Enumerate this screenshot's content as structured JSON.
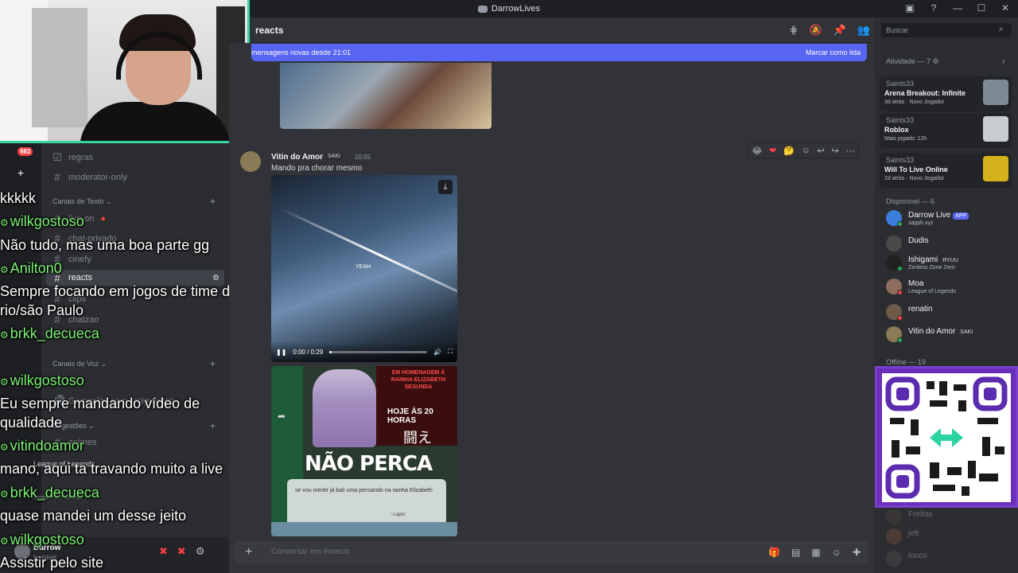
{
  "window": {
    "title": "DarrowLives",
    "controls": [
      "—",
      "☐",
      "✕"
    ]
  },
  "servers": {
    "badge": "983",
    "add_label": "+"
  },
  "channels": {
    "items": [
      {
        "label": "regras",
        "type": "rules"
      },
      {
        "label": "moderator-only",
        "type": "text"
      },
      {
        "label": "live-on",
        "type": "text"
      },
      {
        "label": "chat-privado",
        "type": "text"
      },
      {
        "label": "cinefy",
        "type": "text"
      },
      {
        "label": "reacts",
        "type": "text",
        "active": true
      },
      {
        "label": "clips",
        "type": "text"
      },
      {
        "label": "chatzao",
        "type": "text"
      },
      {
        "label": "Gameplay com amiguinhos",
        "type": "voice"
      },
      {
        "label": "animes",
        "type": "voice"
      }
    ],
    "categories": [
      {
        "label": "Canais de Texto ⌄"
      },
      {
        "label": "Canais de Voz ⌄"
      },
      {
        "label": "Sugestões ⌄"
      }
    ],
    "voice": {
      "game": "League of Legends",
      "sub": "Jogos Priv / valoras"
    }
  },
  "user": {
    "name": "Darrow",
    "status": "Invisível"
  },
  "overlay_chat": [
    {
      "kind": "msg",
      "text": "kkkkk"
    },
    {
      "kind": "user",
      "text": "wilkgostoso"
    },
    {
      "kind": "msg",
      "text": "Não tudo, mas uma boa parte gg"
    },
    {
      "kind": "user",
      "text": "Anilton0"
    },
    {
      "kind": "msg",
      "text": "Sempre focando em jogos de time do"
    },
    {
      "kind": "msg",
      "text": "rio/são Paulo"
    },
    {
      "kind": "user",
      "text": "brkk_decueca"
    },
    {
      "kind": "user",
      "text": "wilkgostoso"
    },
    {
      "kind": "msg",
      "text": "Eu sempre mandando vídeo de"
    },
    {
      "kind": "msg",
      "text": "qualidade"
    },
    {
      "kind": "user",
      "text": "vitindoamor"
    },
    {
      "kind": "msg",
      "text": "mano, aqui ta travando muito a live"
    },
    {
      "kind": "user",
      "text": "brkk_decueca"
    },
    {
      "kind": "msg",
      "text": "quase mandei um desse jeito"
    },
    {
      "kind": "user",
      "text": "wilkgostoso"
    },
    {
      "kind": "msg",
      "text": "Assistir pelo site"
    }
  ],
  "channel_header": {
    "name": "reacts"
  },
  "new_messages": {
    "text": "mensagens novas desde 21:01",
    "action": "Marcar como lida"
  },
  "message": {
    "author": "Vitin do Amor",
    "tag": "SAKI",
    "time": "20:55",
    "text": "Mando pra chorar mesmo",
    "video": {
      "caption": "YEAH",
      "time": "0:00 / 0:29",
      "progress": 0.0
    },
    "image": {
      "banner": "EM HOMENAGEM À RAINHA ELIZABETH SEGUNDA",
      "hoje": "HOJE ÀS 20 HORAS",
      "kanji": "闘え",
      "headline": "NÃO PERCA",
      "quote": "se vou mentir já bati uma pensando na rainha Elizabeth",
      "author": "~Lapto"
    }
  },
  "composer": {
    "placeholder": "Conversar em #reacts",
    "plus": "+"
  },
  "search": {
    "placeholder": "Buscar"
  },
  "activity": {
    "header": "Atividade — 7",
    "cards": [
      {
        "user": "Saints33",
        "game": "Arena Breakout: Infinite",
        "meta": "3d atrás · Novo Jogador",
        "thumb": "#7d8a94"
      },
      {
        "user": "Saints33",
        "game": "Roblox",
        "meta": "Mais jogado: 12h",
        "thumb": "#c9ccd1"
      },
      {
        "user": "Saints33",
        "game": "Will To Live Online",
        "meta": "2d atrás · Novo Jogador",
        "thumb": "#d4b21c"
      }
    ]
  },
  "available": {
    "header": "Disponível — 6",
    "members": [
      {
        "name": "Darrow Live",
        "tag": "APP",
        "sub": "sapph.xyz",
        "color": "#3b7dd8"
      },
      {
        "name": "Dudis",
        "tag": "",
        "sub": "",
        "color": "#4a4a4a"
      },
      {
        "name": "Ishigami",
        "tag": "RYUU",
        "sub": "Zenless Zone Zero",
        "color": "#222"
      },
      {
        "name": "Moa",
        "tag": "",
        "sub": "League of Legends",
        "color": "#8e6e5e"
      },
      {
        "name": "renatin",
        "tag": "",
        "sub": "",
        "color": "#6e5a48"
      },
      {
        "name": "Vitin do Amor",
        "tag": "SAKI",
        "sub": "",
        "color": "#8a7a55"
      }
    ]
  },
  "offline": {
    "header": "Offline — 19",
    "members": [
      "Freitas",
      "jett",
      "louco"
    ]
  }
}
